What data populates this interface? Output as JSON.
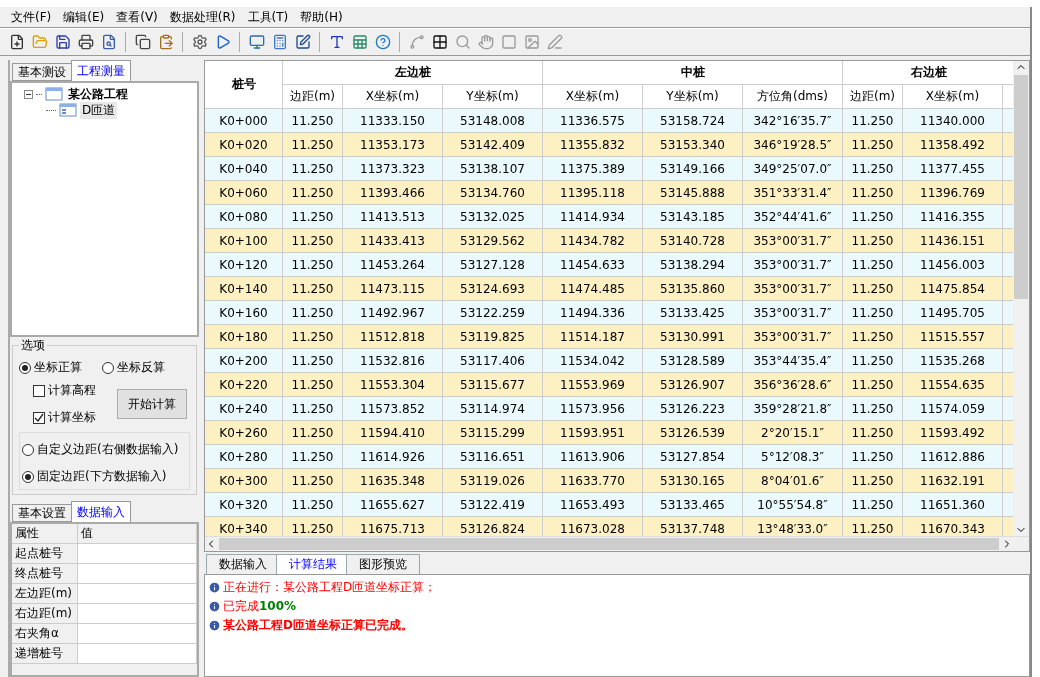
{
  "menu": [
    "文件(F)",
    "编辑(E)",
    "查看(V)",
    "数据处理(R)",
    "工具(T)",
    "帮助(H)"
  ],
  "toolbar": [
    [
      {
        "disabled": false
      },
      {
        "disabled": false
      },
      {
        "disabled": false
      },
      {
        "disabled": false
      },
      {
        "disabled": false
      }
    ],
    [
      {
        "disabled": false
      },
      {
        "disabled": false
      }
    ],
    [
      {
        "disabled": false
      },
      {
        "disabled": false
      }
    ],
    [
      {
        "disabled": false
      },
      {
        "disabled": false
      },
      {
        "disabled": false
      }
    ],
    [
      {
        "disabled": false
      },
      {
        "disabled": false
      },
      {
        "disabled": false
      }
    ],
    [
      {
        "disabled": true
      },
      {
        "disabled": false
      },
      {
        "disabled": true
      },
      {
        "disabled": true
      },
      {
        "disabled": true
      },
      {
        "disabled": true
      },
      {
        "disabled": true
      }
    ]
  ],
  "top_tabs": [
    {
      "label": "基本测设",
      "selected": false
    },
    {
      "label": "工程测量",
      "selected": true
    }
  ],
  "tree": [
    {
      "label": "某公路工程",
      "expanded": true,
      "children": [
        {
          "label": "D匝道",
          "selected": true
        }
      ]
    }
  ],
  "options": {
    "title": "选项",
    "modes": [
      {
        "label": "坐标正算",
        "selected": true
      },
      {
        "label": "坐标反算",
        "selected": false
      }
    ],
    "checks": [
      {
        "label": "计算高程",
        "checked": false
      },
      {
        "label": "计算坐标",
        "checked": true
      }
    ],
    "button": "开始计算",
    "margins": [
      {
        "label": "自定义边距(右侧数据输入)",
        "selected": false
      },
      {
        "label": "固定边距(下方数据输入)",
        "selected": true
      }
    ]
  },
  "bottom_tabs": [
    {
      "label": "基本设置",
      "selected": false
    },
    {
      "label": "数据输入",
      "selected": true
    }
  ],
  "properties": {
    "columns": [
      "属性",
      "值"
    ],
    "rows": [
      "起点桩号",
      "终点桩号",
      "左边距(m)",
      "右边距(m)",
      "右夹角α",
      "递增桩号"
    ]
  },
  "table": {
    "first": "桩号",
    "groups": [
      {
        "label": "左边桩",
        "columns": [
          "边距(m)",
          "X坐标(m)",
          "Y坐标(m)"
        ]
      },
      {
        "label": "中桩",
        "columns": [
          "X坐标(m)",
          "Y坐标(m)",
          "方位角(dms)"
        ]
      },
      {
        "label": "右边桩",
        "columns": [
          "边距(m)",
          "X坐标(m)"
        ]
      }
    ],
    "rows": [
      [
        "K0+000",
        "11.250",
        "11333.150",
        "53148.008",
        "11336.575",
        "53158.724",
        "342°16′35.7″",
        "11.250",
        "11340.000"
      ],
      [
        "K0+020",
        "11.250",
        "11353.173",
        "53142.409",
        "11355.832",
        "53153.340",
        "346°19′28.5″",
        "11.250",
        "11358.492"
      ],
      [
        "K0+040",
        "11.250",
        "11373.323",
        "53138.107",
        "11375.389",
        "53149.166",
        "349°25′07.0″",
        "11.250",
        "11377.455"
      ],
      [
        "K0+060",
        "11.250",
        "11393.466",
        "53134.760",
        "11395.118",
        "53145.888",
        "351°33′31.4″",
        "11.250",
        "11396.769"
      ],
      [
        "K0+080",
        "11.250",
        "11413.513",
        "53132.025",
        "11414.934",
        "53143.185",
        "352°44′41.6″",
        "11.250",
        "11416.355"
      ],
      [
        "K0+100",
        "11.250",
        "11433.413",
        "53129.562",
        "11434.782",
        "53140.728",
        "353°00′31.7″",
        "11.250",
        "11436.151"
      ],
      [
        "K0+120",
        "11.250",
        "11453.264",
        "53127.128",
        "11454.633",
        "53138.294",
        "353°00′31.7″",
        "11.250",
        "11456.003"
      ],
      [
        "K0+140",
        "11.250",
        "11473.115",
        "53124.693",
        "11474.485",
        "53135.860",
        "353°00′31.7″",
        "11.250",
        "11475.854"
      ],
      [
        "K0+160",
        "11.250",
        "11492.967",
        "53122.259",
        "11494.336",
        "53133.425",
        "353°00′31.7″",
        "11.250",
        "11495.705"
      ],
      [
        "K0+180",
        "11.250",
        "11512.818",
        "53119.825",
        "11514.187",
        "53130.991",
        "353°00′31.7″",
        "11.250",
        "11515.557"
      ],
      [
        "K0+200",
        "11.250",
        "11532.816",
        "53117.406",
        "11534.042",
        "53128.589",
        "353°44′35.4″",
        "11.250",
        "11535.268"
      ],
      [
        "K0+220",
        "11.250",
        "11553.304",
        "53115.677",
        "11553.969",
        "53126.907",
        "356°36′28.6″",
        "11.250",
        "11554.635"
      ],
      [
        "K0+240",
        "11.250",
        "11573.852",
        "53114.974",
        "11573.956",
        "53126.223",
        "359°28′21.8″",
        "11.250",
        "11574.059"
      ],
      [
        "K0+260",
        "11.250",
        "11594.410",
        "53115.299",
        "11593.951",
        "53126.539",
        "2°20′15.1″",
        "11.250",
        "11593.492"
      ],
      [
        "K0+280",
        "11.250",
        "11614.926",
        "53116.651",
        "11613.906",
        "53127.854",
        "5°12′08.3″",
        "11.250",
        "11612.886"
      ],
      [
        "K0+300",
        "11.250",
        "11635.348",
        "53119.026",
        "11633.770",
        "53130.165",
        "8°04′01.6″",
        "11.250",
        "11632.191"
      ],
      [
        "K0+320",
        "11.250",
        "11655.627",
        "53122.419",
        "11653.493",
        "53133.465",
        "10°55′54.8″",
        "11.250",
        "11651.360"
      ],
      [
        "K0+340",
        "11.250",
        "11675.713",
        "53126.824",
        "11673.028",
        "53137.748",
        "13°48′33.0″",
        "11.250",
        "11670.343"
      ]
    ]
  },
  "result_tabs": [
    {
      "label": "数据输入",
      "selected": false
    },
    {
      "label": "计算结果",
      "selected": true
    },
    {
      "label": "图形预览",
      "selected": false
    }
  ],
  "log": [
    [
      {
        "text": "正在进行：某公路工程D匝道坐标正算；",
        "kind": "normal"
      }
    ],
    [
      {
        "text": "已完成",
        "kind": "normal"
      },
      {
        "text": "100%",
        "kind": "percent"
      }
    ],
    [
      {
        "text": "某公路工程D匝道坐标正算已完成。",
        "kind": "emphasis"
      }
    ]
  ]
}
